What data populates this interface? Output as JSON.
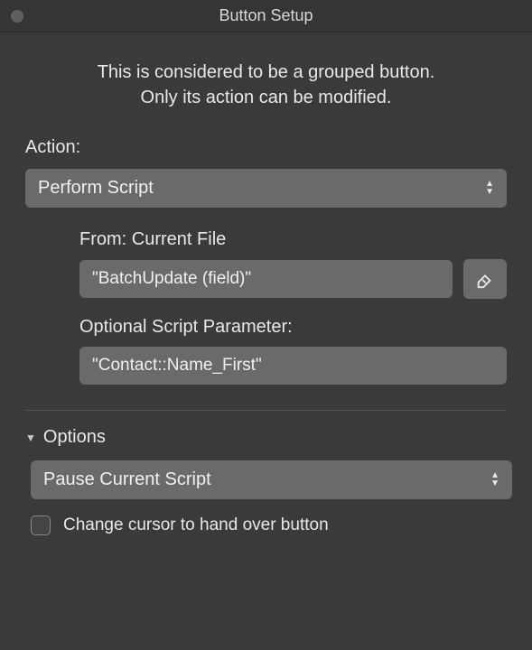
{
  "window": {
    "title": "Button Setup"
  },
  "intro": {
    "line1": "This is considered to be a grouped button.",
    "line2": "Only its action can be modified."
  },
  "action": {
    "label": "Action:",
    "selected": "Perform Script"
  },
  "from": {
    "label": "From:",
    "value": "Current File"
  },
  "script": {
    "name": "\"BatchUpdate (field)\""
  },
  "parameter": {
    "label": "Optional Script Parameter:",
    "value": "\"Contact::Name_First\""
  },
  "options": {
    "header": "Options",
    "selected": "Pause Current Script",
    "checkbox_label": "Change cursor to hand over button",
    "checkbox_checked": false
  }
}
